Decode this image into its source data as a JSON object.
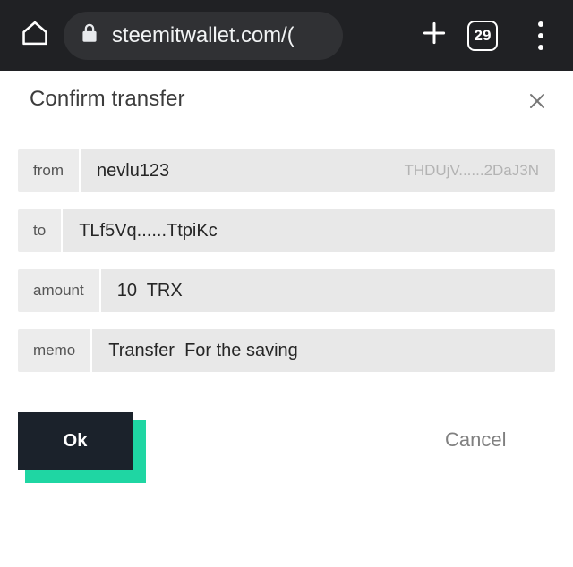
{
  "browser": {
    "home_icon": "home-icon",
    "lock_icon": "lock-icon",
    "url": "steemitwallet.com/(",
    "new_tab_icon": "plus-icon",
    "tab_count": "29",
    "menu_icon": "overflow-menu-icon"
  },
  "dialog": {
    "title": "Confirm transfer",
    "close_icon": "close-icon",
    "fields": [
      {
        "label": "from",
        "value": "nevlu123",
        "aux": "THDUjV......2DaJ3N"
      },
      {
        "label": "to",
        "value": "TLf5Vq......TtpiKc",
        "aux": ""
      },
      {
        "label": "amount",
        "value": "10  TRX",
        "aux": ""
      },
      {
        "label": "memo",
        "value": "Transfer  For the saving",
        "aux": ""
      }
    ],
    "confirm_label": "Ok",
    "cancel_label": "Cancel"
  },
  "colors": {
    "chrome_bg": "#202124",
    "accent_teal": "#1fd6a3",
    "button_dark": "#1b222b",
    "field_bg": "#e8e8e8",
    "label_bg": "#ececec"
  }
}
